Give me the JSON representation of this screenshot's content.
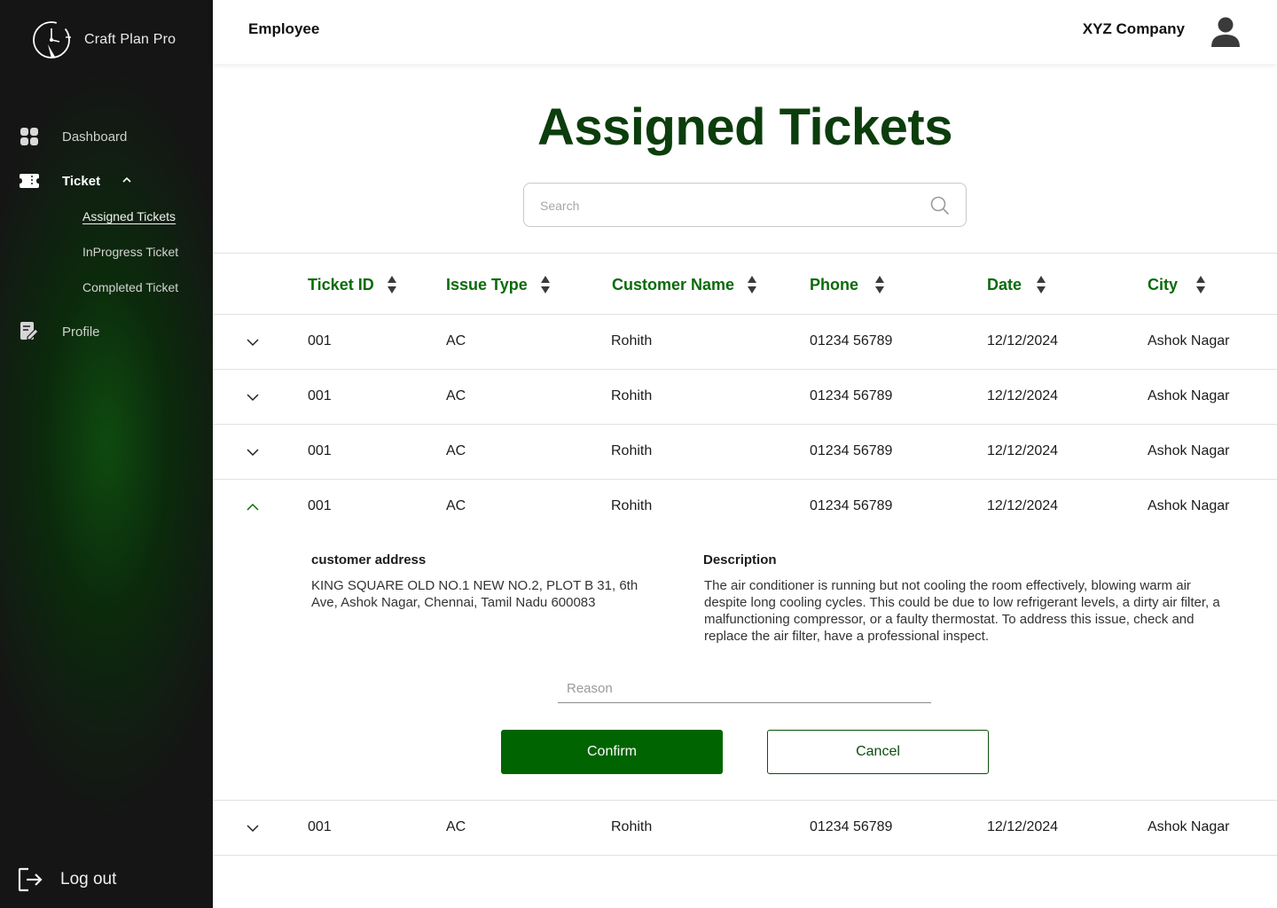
{
  "brand": {
    "name": "Craft Plan Pro",
    "logo_icon": "clock-logo-icon"
  },
  "sidebar": {
    "items": [
      {
        "label": "Dashboard",
        "icon": "dashboard-grid-icon"
      },
      {
        "label": "Ticket",
        "icon": "ticket-icon",
        "expanded": true
      },
      {
        "label": "Profile",
        "icon": "profile-edit-icon"
      }
    ],
    "ticket_subitems": [
      {
        "label": "Assigned Tickets",
        "current": true
      },
      {
        "label": "InProgress Ticket"
      },
      {
        "label": "Completed Ticket"
      }
    ],
    "logout_label": "Log out"
  },
  "header": {
    "title": "Employee",
    "company": "XYZ Company"
  },
  "main": {
    "title": "Assigned Tickets",
    "search_placeholder": "Search"
  },
  "table": {
    "columns": [
      "Ticket ID",
      "Issue Type",
      "Customer Name",
      "Phone",
      "Date",
      "City"
    ],
    "rows": [
      {
        "ticket_id": "001",
        "issue_type": "AC",
        "customer": "Rohith",
        "phone": "01234 56789",
        "date": "12/12/2024",
        "city": "Ashok Nagar",
        "expanded": false
      },
      {
        "ticket_id": "001",
        "issue_type": "AC",
        "customer": "Rohith",
        "phone": "01234 56789",
        "date": "12/12/2024",
        "city": "Ashok Nagar",
        "expanded": false
      },
      {
        "ticket_id": "001",
        "issue_type": "AC",
        "customer": "Rohith",
        "phone": "01234 56789",
        "date": "12/12/2024",
        "city": "Ashok Nagar",
        "expanded": false
      },
      {
        "ticket_id": "001",
        "issue_type": "AC",
        "customer": "Rohith",
        "phone": "01234 56789",
        "date": "12/12/2024",
        "city": "Ashok Nagar",
        "expanded": true
      },
      {
        "ticket_id": "001",
        "issue_type": "AC",
        "customer": "Rohith",
        "phone": "01234 56789",
        "date": "12/12/2024",
        "city": "Ashok Nagar",
        "expanded": false
      }
    ],
    "detail": {
      "address_label": "customer address",
      "address_text": "KING SQUARE OLD NO.1 NEW NO.2, PLOT B 31, 6th Ave, Ashok Nagar, Chennai, Tamil Nadu 600083",
      "description_label": "Description",
      "description_text": "The air conditioner is running but not cooling the room effectively, blowing warm air despite long cooling cycles. This could be due to low refrigerant levels, a dirty air filter, a malfunctioning compressor, or a faulty thermostat. To address this issue, check and replace the air filter, have a professional inspect.",
      "reason_placeholder": "Reason",
      "confirm_label": "Confirm",
      "cancel_label": "Cancel"
    }
  },
  "colors": {
    "accent_green": "#0b6b0b",
    "title_green": "#0c3d0c",
    "confirm_green": "#006400",
    "sidebar_dark": "#151515"
  }
}
